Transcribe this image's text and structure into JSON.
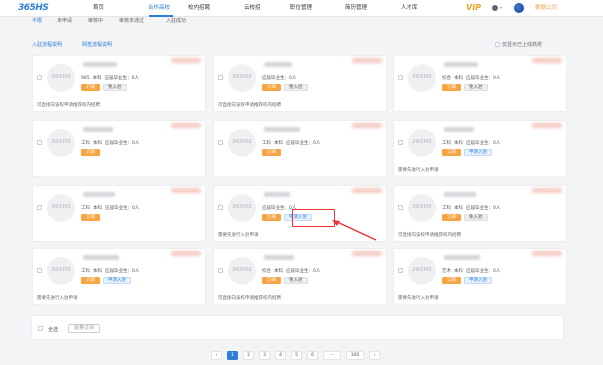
{
  "header": {
    "logo": "365HS",
    "nav": [
      "首页",
      "合作高校",
      "校内招聘",
      "云校招",
      "职位管理",
      "简历管理",
      "人才库"
    ],
    "active_nav": 1,
    "vip": "VIP",
    "school_name": "数据公司"
  },
  "subtabs": {
    "items": [
      "不限",
      "未申请",
      "审核中",
      "审核未通过",
      "入驻成功"
    ],
    "active": 0
  },
  "links": {
    "process": "入驻流程说明",
    "campus_help": "网签流程说明",
    "only_show": "仅显示已上线高校"
  },
  "avatar_text": "365HS",
  "cards": [
    {
      "tags": [
        "985",
        "本科",
        "应届毕业生：0人"
      ],
      "buttons": [
        {
          "label": "订阅",
          "type": "orange"
        },
        {
          "label": "免入驻",
          "type": "gray"
        }
      ],
      "note": "可直接向该校申请推荐校内招聘"
    },
    {
      "tags": [
        "应届毕业生：0人"
      ],
      "buttons": [
        {
          "label": "订阅",
          "type": "orange"
        },
        {
          "label": "免入驻",
          "type": "gray"
        }
      ],
      "note": "可直接向该校申请推荐校内招聘"
    },
    {
      "tags": [
        "综合",
        "本科",
        "应届毕业生：0人"
      ],
      "buttons": [
        {
          "label": "订阅",
          "type": "orange"
        },
        {
          "label": "免入驻",
          "type": "gray"
        }
      ],
      "note": ""
    },
    {
      "tags": [
        "工科",
        "本科",
        "应届毕业生：0人"
      ],
      "buttons": [
        {
          "label": "订阅",
          "type": "orange"
        }
      ],
      "note": ""
    },
    {
      "tags": [
        "工科",
        "本科",
        "应届毕业生：0人"
      ],
      "buttons": [
        {
          "label": "订阅",
          "type": "orange"
        }
      ],
      "note": ""
    },
    {
      "tags": [
        "工科",
        "本科",
        "应届毕业生：0人"
      ],
      "buttons": [
        {
          "label": "订阅",
          "type": "orange"
        },
        {
          "label": "申请入驻",
          "type": "blue"
        }
      ],
      "note": "需要先进行入驻申请"
    },
    {
      "tags": [
        "工科",
        "本科",
        "应届毕业生：0人"
      ],
      "buttons": [
        {
          "label": "订阅",
          "type": "orange"
        }
      ],
      "note": ""
    },
    {
      "tags": [
        "应届毕业生：0人"
      ],
      "buttons": [
        {
          "label": "订阅",
          "type": "orange"
        },
        {
          "label": "申请入驻",
          "type": "blue"
        }
      ],
      "note": "需要先进行入驻申请"
    },
    {
      "tags": [
        "工科",
        "本科",
        "应届毕业生：0人"
      ],
      "buttons": [
        {
          "label": "订阅",
          "type": "orange"
        },
        {
          "label": "免入驻",
          "type": "gray"
        }
      ],
      "note": "可直接向该校申请推荐校内招聘"
    },
    {
      "tags": [
        "工科",
        "本科",
        "应届毕业生：0人"
      ],
      "buttons": [
        {
          "label": "订阅",
          "type": "orange"
        },
        {
          "label": "申请入驻",
          "type": "blue"
        }
      ],
      "note": "需要先进行入驻申请"
    },
    {
      "tags": [
        "综合",
        "本科",
        "应届毕业生：0人"
      ],
      "buttons": [
        {
          "label": "订阅",
          "type": "orange"
        },
        {
          "label": "免入驻",
          "type": "gray"
        }
      ],
      "note": "可直接向该校申请推荐校内招聘"
    },
    {
      "tags": [
        "艺术",
        "本科",
        "应届毕业生：0人"
      ],
      "buttons": [
        {
          "label": "订阅",
          "type": "orange"
        },
        {
          "label": "申请入驻",
          "type": "blue"
        }
      ],
      "note": "需要先进行入驻申请"
    }
  ],
  "bottom": {
    "select_all": "全选",
    "batch": "批量订阅"
  },
  "pager": {
    "prev": "‹",
    "pages": [
      "1",
      "2",
      "3",
      "4",
      "5",
      "6",
      "···",
      "300"
    ],
    "next": "›",
    "active": 0
  },
  "colors": {
    "accent": "#2f7fd9",
    "subscribe": "#f7a442",
    "highlight": "#e33333"
  }
}
